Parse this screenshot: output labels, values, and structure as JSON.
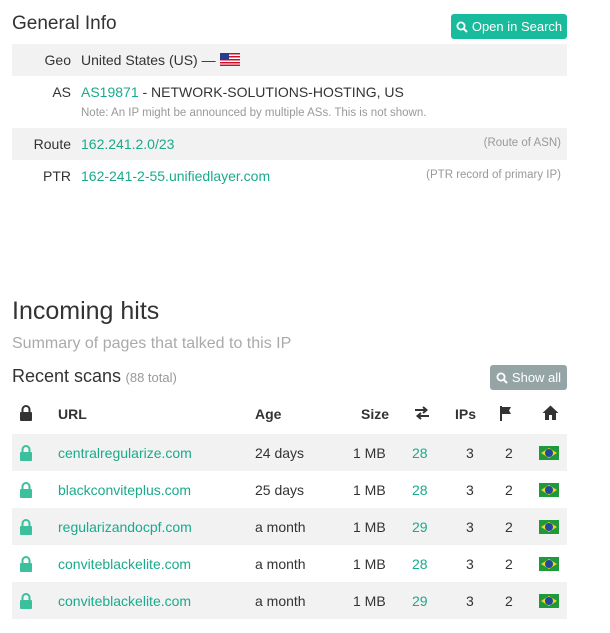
{
  "general": {
    "title": "General Info",
    "open_search_label": "Open in Search",
    "geo_label": "Geo",
    "geo_value": "United States (US) —",
    "as_label": "AS",
    "as_number": "AS19871",
    "as_name": " - NETWORK-SOLUTIONS-HOSTING, US",
    "as_note": "Note: An IP might be announced by multiple ASs. This is not shown.",
    "route_label": "Route",
    "route_value": "162.241.2.0/23",
    "route_hint": "(Route of ASN)",
    "ptr_label": "PTR",
    "ptr_value": "162-241-2-55.unifiedlayer.com",
    "ptr_hint": "(PTR record of primary IP)"
  },
  "incoming": {
    "title": "Incoming hits",
    "subtitle": "Summary of pages that talked to this IP"
  },
  "recent": {
    "title": "Recent scans",
    "count": "(88 total)",
    "show_all_label": "Show all",
    "headers": {
      "url": "URL",
      "age": "Age",
      "size": "Size",
      "ips": "IPs"
    },
    "rows": [
      {
        "url": "centralregularize.com",
        "age": "24 days",
        "size": "1 MB",
        "requests": "28",
        "ips": "3",
        "countries": "2"
      },
      {
        "url": "blackconviteplus.com",
        "age": "25 days",
        "size": "1 MB",
        "requests": "28",
        "ips": "3",
        "countries": "2"
      },
      {
        "url": "regularizandocpf.com",
        "age": "a month",
        "size": "1 MB",
        "requests": "29",
        "ips": "3",
        "countries": "2"
      },
      {
        "url": "conviteblackelite.com",
        "age": "a month",
        "size": "1 MB",
        "requests": "28",
        "ips": "3",
        "countries": "2"
      },
      {
        "url": "conviteblackelite.com",
        "age": "a month",
        "size": "1 MB",
        "requests": "29",
        "ips": "3",
        "countries": "2"
      }
    ]
  },
  "colors": {
    "accent": "#18bc9c",
    "link": "#1aaa8c",
    "muted": "#999999",
    "button_gray": "#95a5a6"
  },
  "icons": [
    "search-icon",
    "us-flag-icon",
    "lock-icon",
    "transfer-icon",
    "flag-icon",
    "home-icon",
    "brazil-flag-icon"
  ]
}
